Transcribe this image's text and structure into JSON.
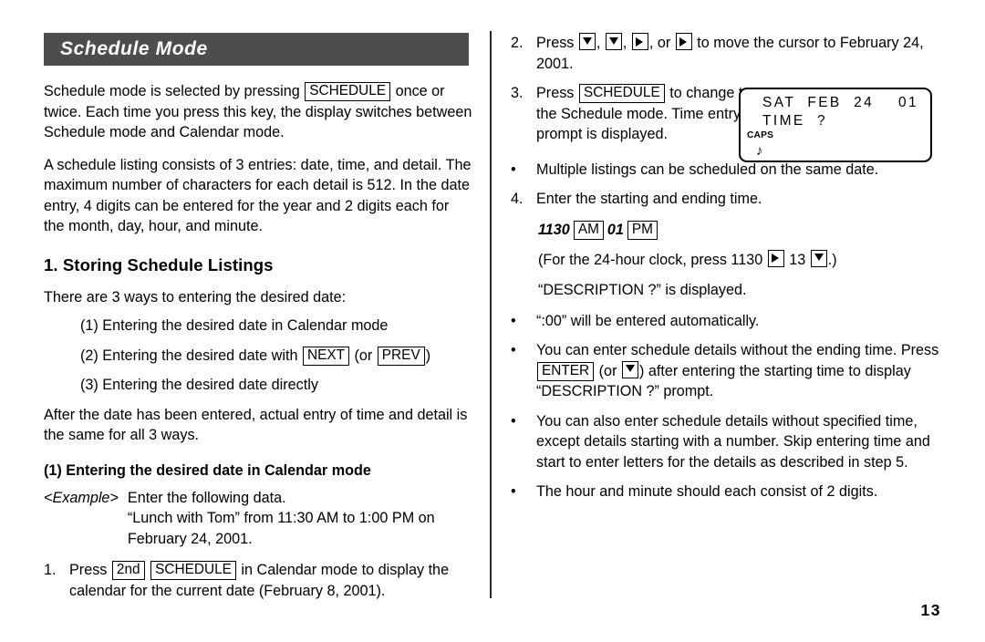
{
  "page": {
    "number": "13",
    "section_title": "Schedule Mode"
  },
  "left_column": {
    "intro_paragraph_1": {
      "part_a": "Schedule mode is selected by pressing",
      "key_schedule": "SCHEDULE",
      "part_b": "once or twice. Each time you press this key, the display switches between Schedule mode and Calendar mode."
    },
    "intro_paragraph_2": "A schedule listing consists of 3 entries: date, time, and detail. The maximum number of characters for each detail is 512. In the date entry, 4 digits can be entered for the year and 2 digits each for the month, day, hour, and minute.",
    "heading_storing": "1. Storing Schedule Listings",
    "ways_lead_in": "There are 3 ways to entering the desired date:",
    "way_1": "(1) Entering the desired date in Calendar mode",
    "way_2": {
      "part_a": "(2) Entering the desired date with",
      "key_next": "NEXT",
      "part_b": "(or",
      "key_prev": "PREV",
      "part_c": ")"
    },
    "way_3": "(3) Entering the desired date directly",
    "after_date_paragraph": "After the date has been entered, actual entry of time and detail is the same for all 3 ways.",
    "subheading_1": "(1)  Entering the desired date in Calendar mode",
    "example": {
      "label": "<Example>",
      "line_1": "Enter the following data.",
      "line_2": "“Lunch with Tom” from 11:30 AM to 1:00 PM on February 24, 2001."
    },
    "step_1": {
      "marker": "1.",
      "part_a": "Press",
      "key_2nd": "2nd",
      "key_schedule": "SCHEDULE",
      "part_b": "in Calendar mode to display the calendar for the current date (February 8, 2001)."
    }
  },
  "right_column": {
    "step_2": {
      "marker": "2.",
      "part_a": "Press",
      "keys": [
        "down-arrow",
        "down-arrow",
        "right-arrow",
        "right-arrow"
      ],
      "separator_or": ", or",
      "part_b": "to move the cursor to February 24, 2001."
    },
    "step_3": {
      "marker": "3.",
      "part_a": "Press",
      "key_schedule": "SCHEDULE",
      "part_b": "to change to the Schedule mode. Time entry prompt  is displayed."
    },
    "bullet_multiple": {
      "marker": "•",
      "text": "Multiple listings can be scheduled on the same date."
    },
    "step_4": {
      "marker": "4.",
      "text": "Enter the starting and ending time."
    },
    "time_sequence": {
      "start_time": "1130",
      "key_am": "AM",
      "end_time": "01",
      "key_pm": "PM"
    },
    "clock_24_note": {
      "part_a": "(For the 24-hour clock, press 1130",
      "key_right": "right-arrow",
      "part_b": "13",
      "key_down": "down-arrow",
      "part_c": ".)"
    },
    "description_prompt_line": "“DESCRIPTION ?” is displayed.",
    "bullet_00": {
      "marker": "•",
      "text": "“:00” will be entered automatically."
    },
    "bullet_without_ending": {
      "marker": "•",
      "part_a": "You can enter schedule details without the ending time. Press",
      "key_enter": "ENTER",
      "part_b": "(or",
      "key_down": "down-arrow",
      "part_c": ") after entering the starting time to display “DESCRIPTION ?” prompt."
    },
    "bullet_without_time": {
      "marker": "•",
      "text": "You can also enter schedule details without specified time, except details starting with a number. Skip entering time and start to enter letters for the details as described in step 5."
    },
    "bullet_two_digits": {
      "marker": "•",
      "text": "The hour and minute should each consist of 2 digits."
    }
  },
  "lcd_display": {
    "line_1": "SAT  FEB  24    01",
    "line_2": "TIME  ?",
    "caps_indicator": "CAPS",
    "note_indicator": "♪"
  },
  "colors": {
    "banner_background": "#4d4d4d",
    "banner_text": "#ffffff",
    "body_text": "#000000",
    "page_background": "#ffffff"
  }
}
